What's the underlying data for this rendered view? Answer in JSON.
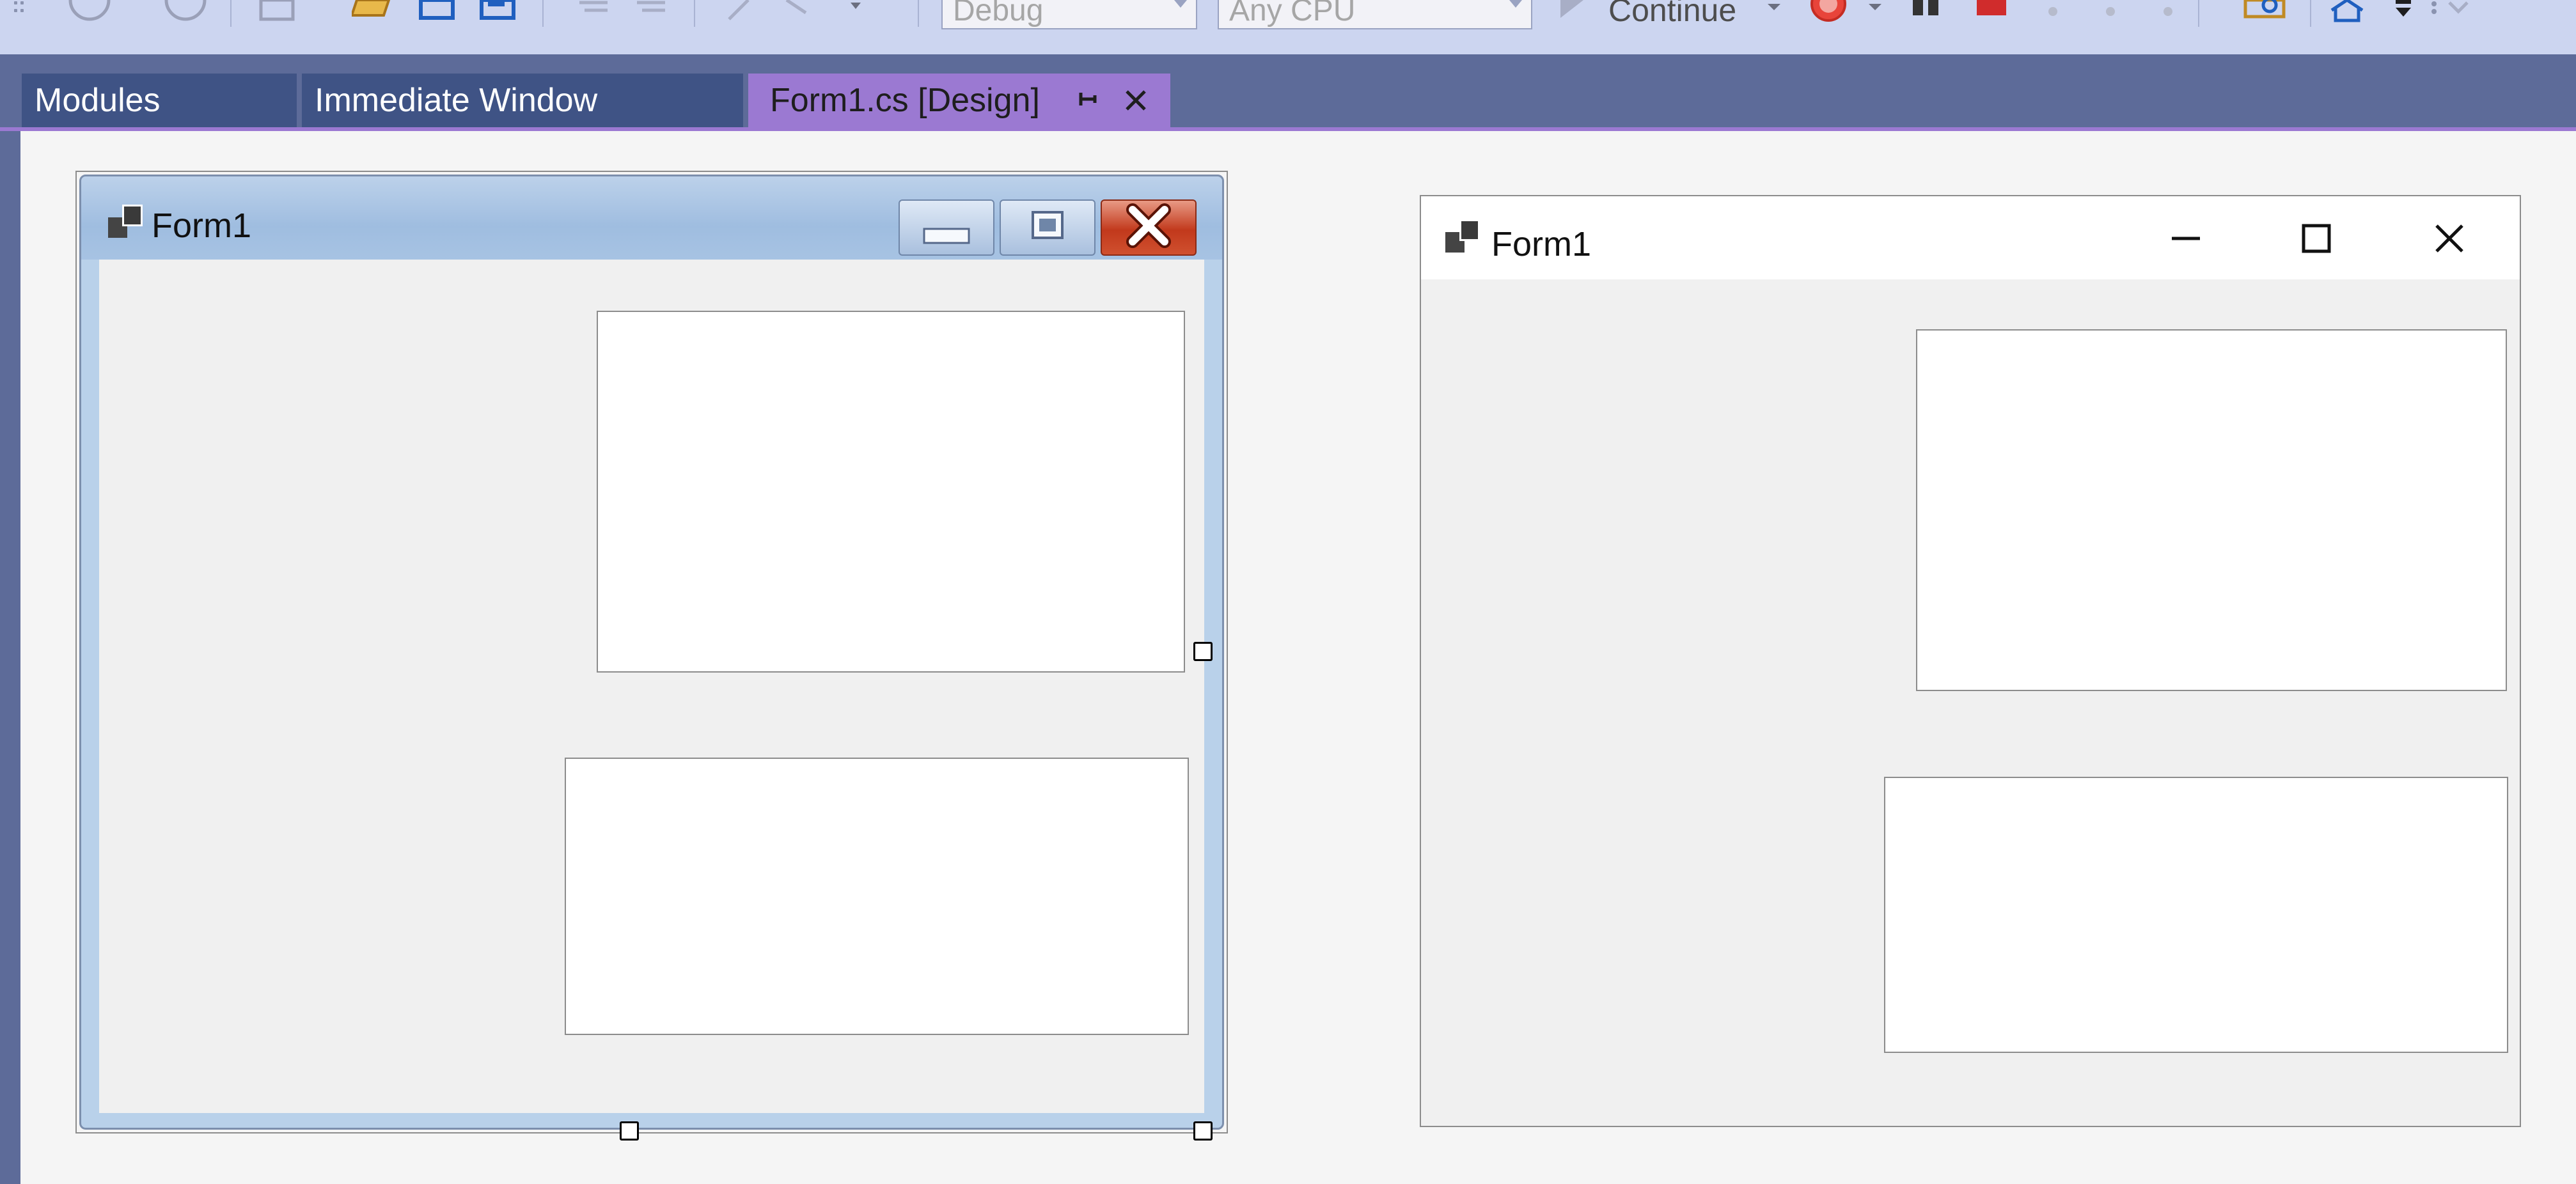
{
  "toolbar": {
    "configuration": "Debug",
    "platform": "Any CPU",
    "continue_label": "Continue",
    "icons": [
      "back-icon",
      "forward-icon",
      "new-project-icon",
      "open-folder-icon",
      "save-icon",
      "save-all-icon",
      "comment-icon",
      "uncomment-icon",
      "step-icon",
      "continue-icon",
      "breakpoint-icon",
      "pause-icon",
      "stop-icon",
      "find-icon",
      "home-icon"
    ]
  },
  "tabs": [
    {
      "label": "Modules",
      "active": false
    },
    {
      "label": "Immediate Window",
      "active": false
    },
    {
      "label": "Form1.cs [Design]",
      "active": true
    }
  ],
  "designer_form": {
    "title": "Form1"
  },
  "runtime_form": {
    "title": "Form1"
  },
  "colors": {
    "toolbar": "#ccd5f0",
    "tab_strip": "#5d6b99",
    "inactive_tab": "#3f5385",
    "active_tab": "#9b79d2",
    "surface": "#f5f5f5",
    "classic_frame": "#b9d1ea",
    "close_red": "#c2391c"
  }
}
